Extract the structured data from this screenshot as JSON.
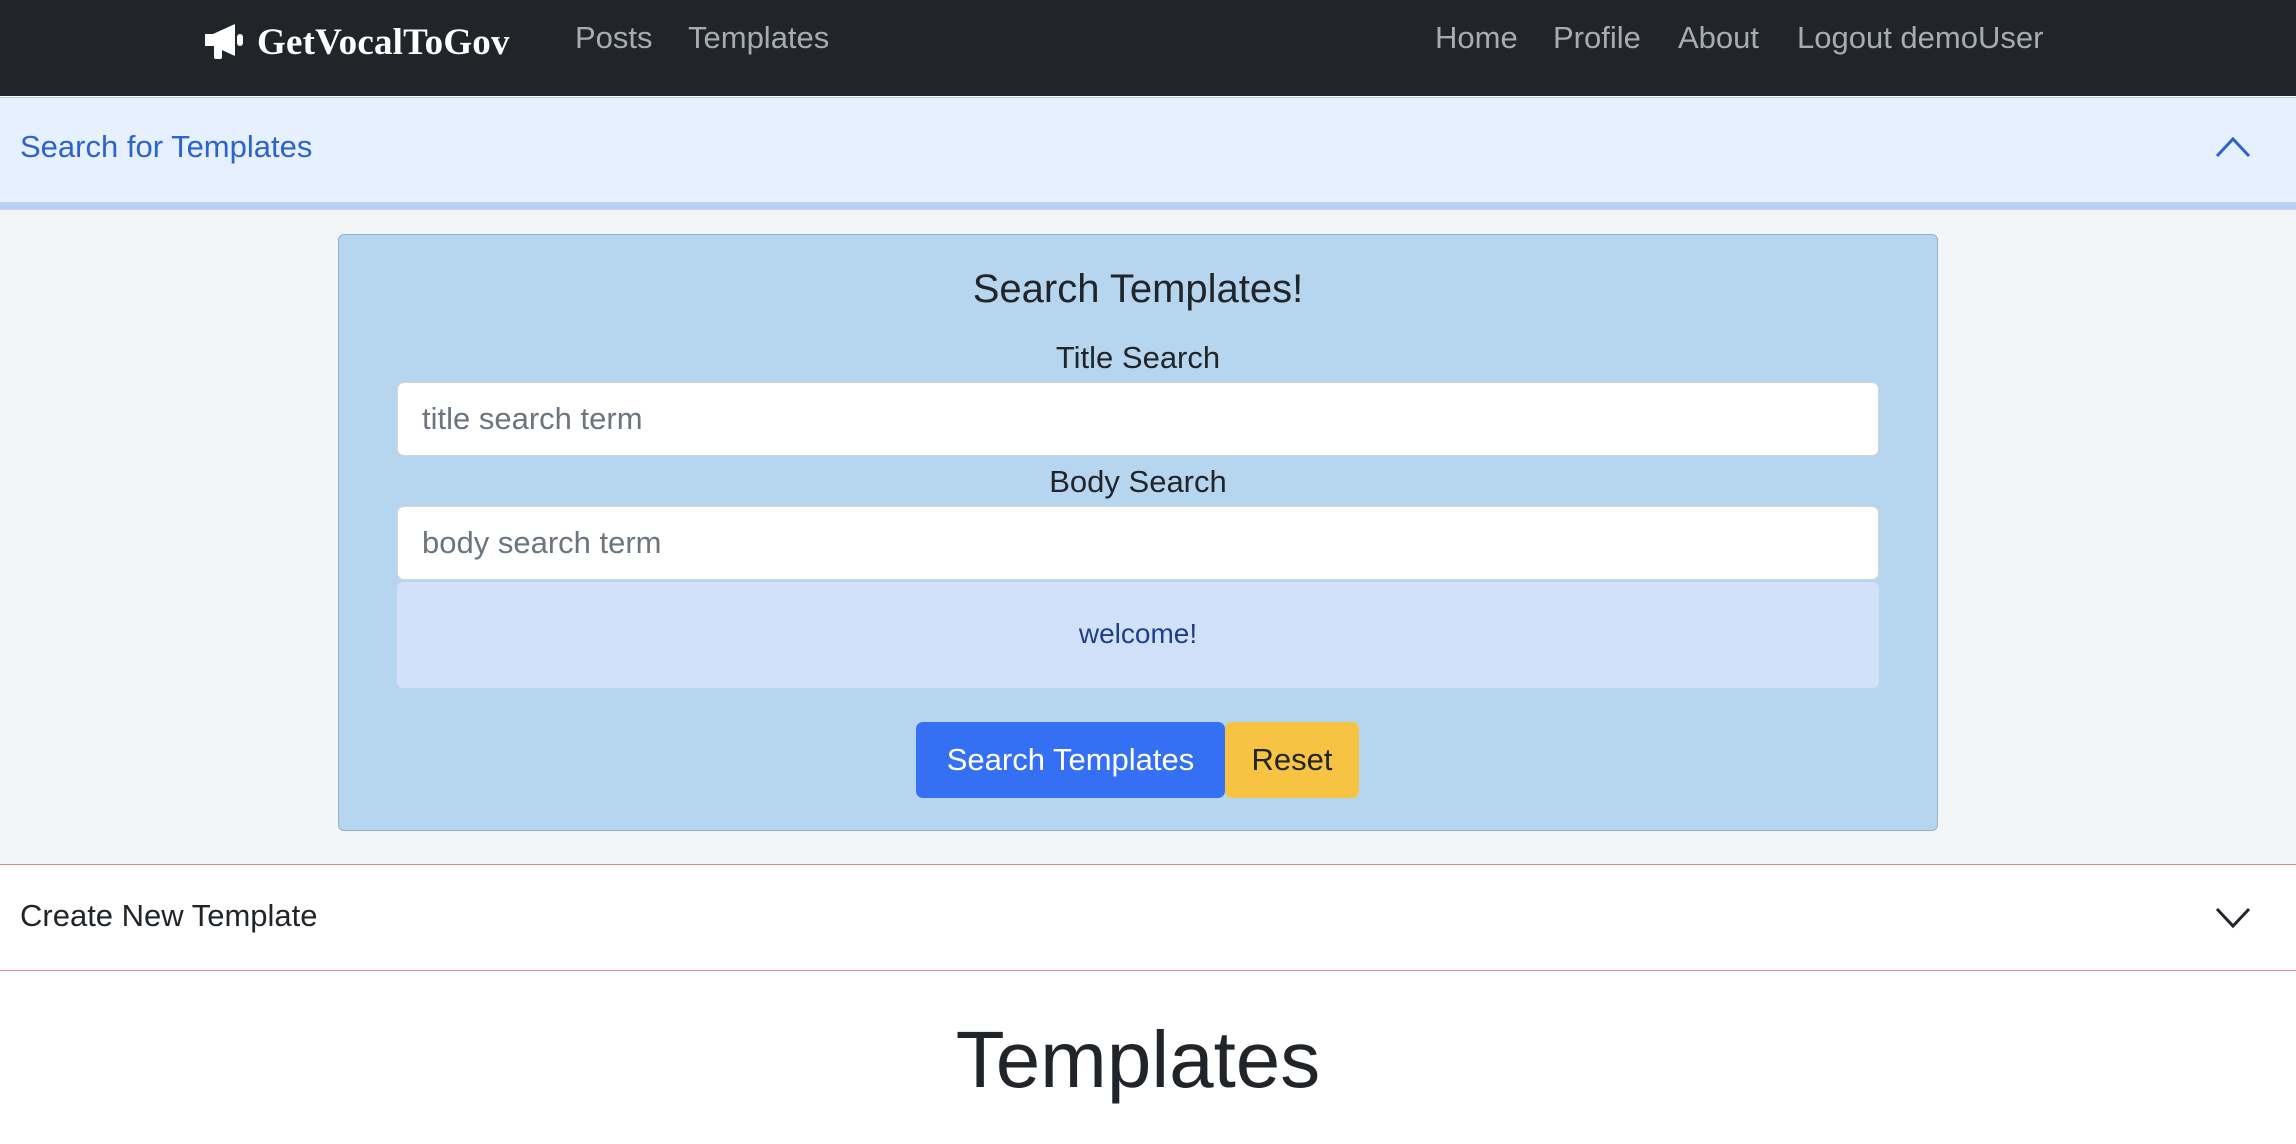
{
  "navbar": {
    "brand": "GetVocalToGov",
    "brand_icon": "megaphone-icon",
    "left_links": [
      "Posts",
      "Templates"
    ],
    "right_links": [
      "Home",
      "Profile",
      "About",
      "Logout demoUser"
    ]
  },
  "search_accordion": {
    "title": "Search for Templates",
    "expanded": true,
    "chevron_icon": "chevron-up-icon"
  },
  "search_card": {
    "heading": "Search Templates!",
    "title_label": "Title Search",
    "title_placeholder": "title search term",
    "title_value": "",
    "body_label": "Body Search",
    "body_placeholder": "body search term",
    "body_value": "",
    "alert_message": "welcome!",
    "search_button": "Search Templates",
    "reset_button": "Reset"
  },
  "create_accordion": {
    "title": "Create New Template",
    "expanded": false,
    "chevron_icon": "chevron-down-icon"
  },
  "page_heading": "Templates",
  "colors": {
    "navbar_bg": "#212529",
    "accent_blue": "#346ff4",
    "reset_yellow": "#f7c343",
    "card_bg": "#b6d5ee",
    "alert_bg": "#d2e1fa",
    "accordion_active_bg": "#e7f0ff",
    "accordion_active_text": "#2b63cf"
  }
}
